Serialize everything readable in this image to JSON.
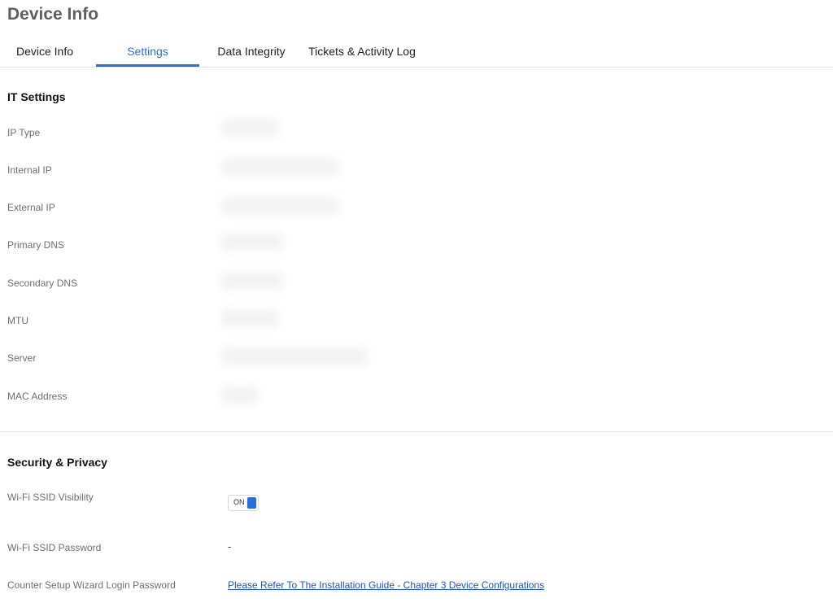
{
  "page": {
    "title": "Device Info"
  },
  "tabs": [
    {
      "label": "Device Info",
      "active": false
    },
    {
      "label": "Settings",
      "active": true
    },
    {
      "label": "Data Integrity",
      "active": false
    },
    {
      "label": "Tickets & Activity Log",
      "active": false
    }
  ],
  "it_settings": {
    "title": "IT Settings",
    "rows": [
      {
        "label": "IP Type"
      },
      {
        "label": "Internal IP"
      },
      {
        "label": "External IP"
      },
      {
        "label": "Primary DNS"
      },
      {
        "label": "Secondary DNS"
      },
      {
        "label": "MTU"
      },
      {
        "label": "Server"
      },
      {
        "label": "MAC Address"
      }
    ]
  },
  "security": {
    "title": "Security & Privacy",
    "ssid_visibility": {
      "label": "Wi-Fi SSID Visibility",
      "toggle_text": "ON",
      "on": true
    },
    "ssid_password": {
      "label": "Wi-Fi SSID Password",
      "value": "-"
    },
    "counter_setup": {
      "label": "Counter Setup Wizard Login Password",
      "link": "Please Refer To The Installation Guide - Chapter 3 Device Configurations"
    }
  },
  "colors": {
    "accent": "#2a6fd6",
    "link": "#1a55c9",
    "label": "#6f6f6f"
  }
}
